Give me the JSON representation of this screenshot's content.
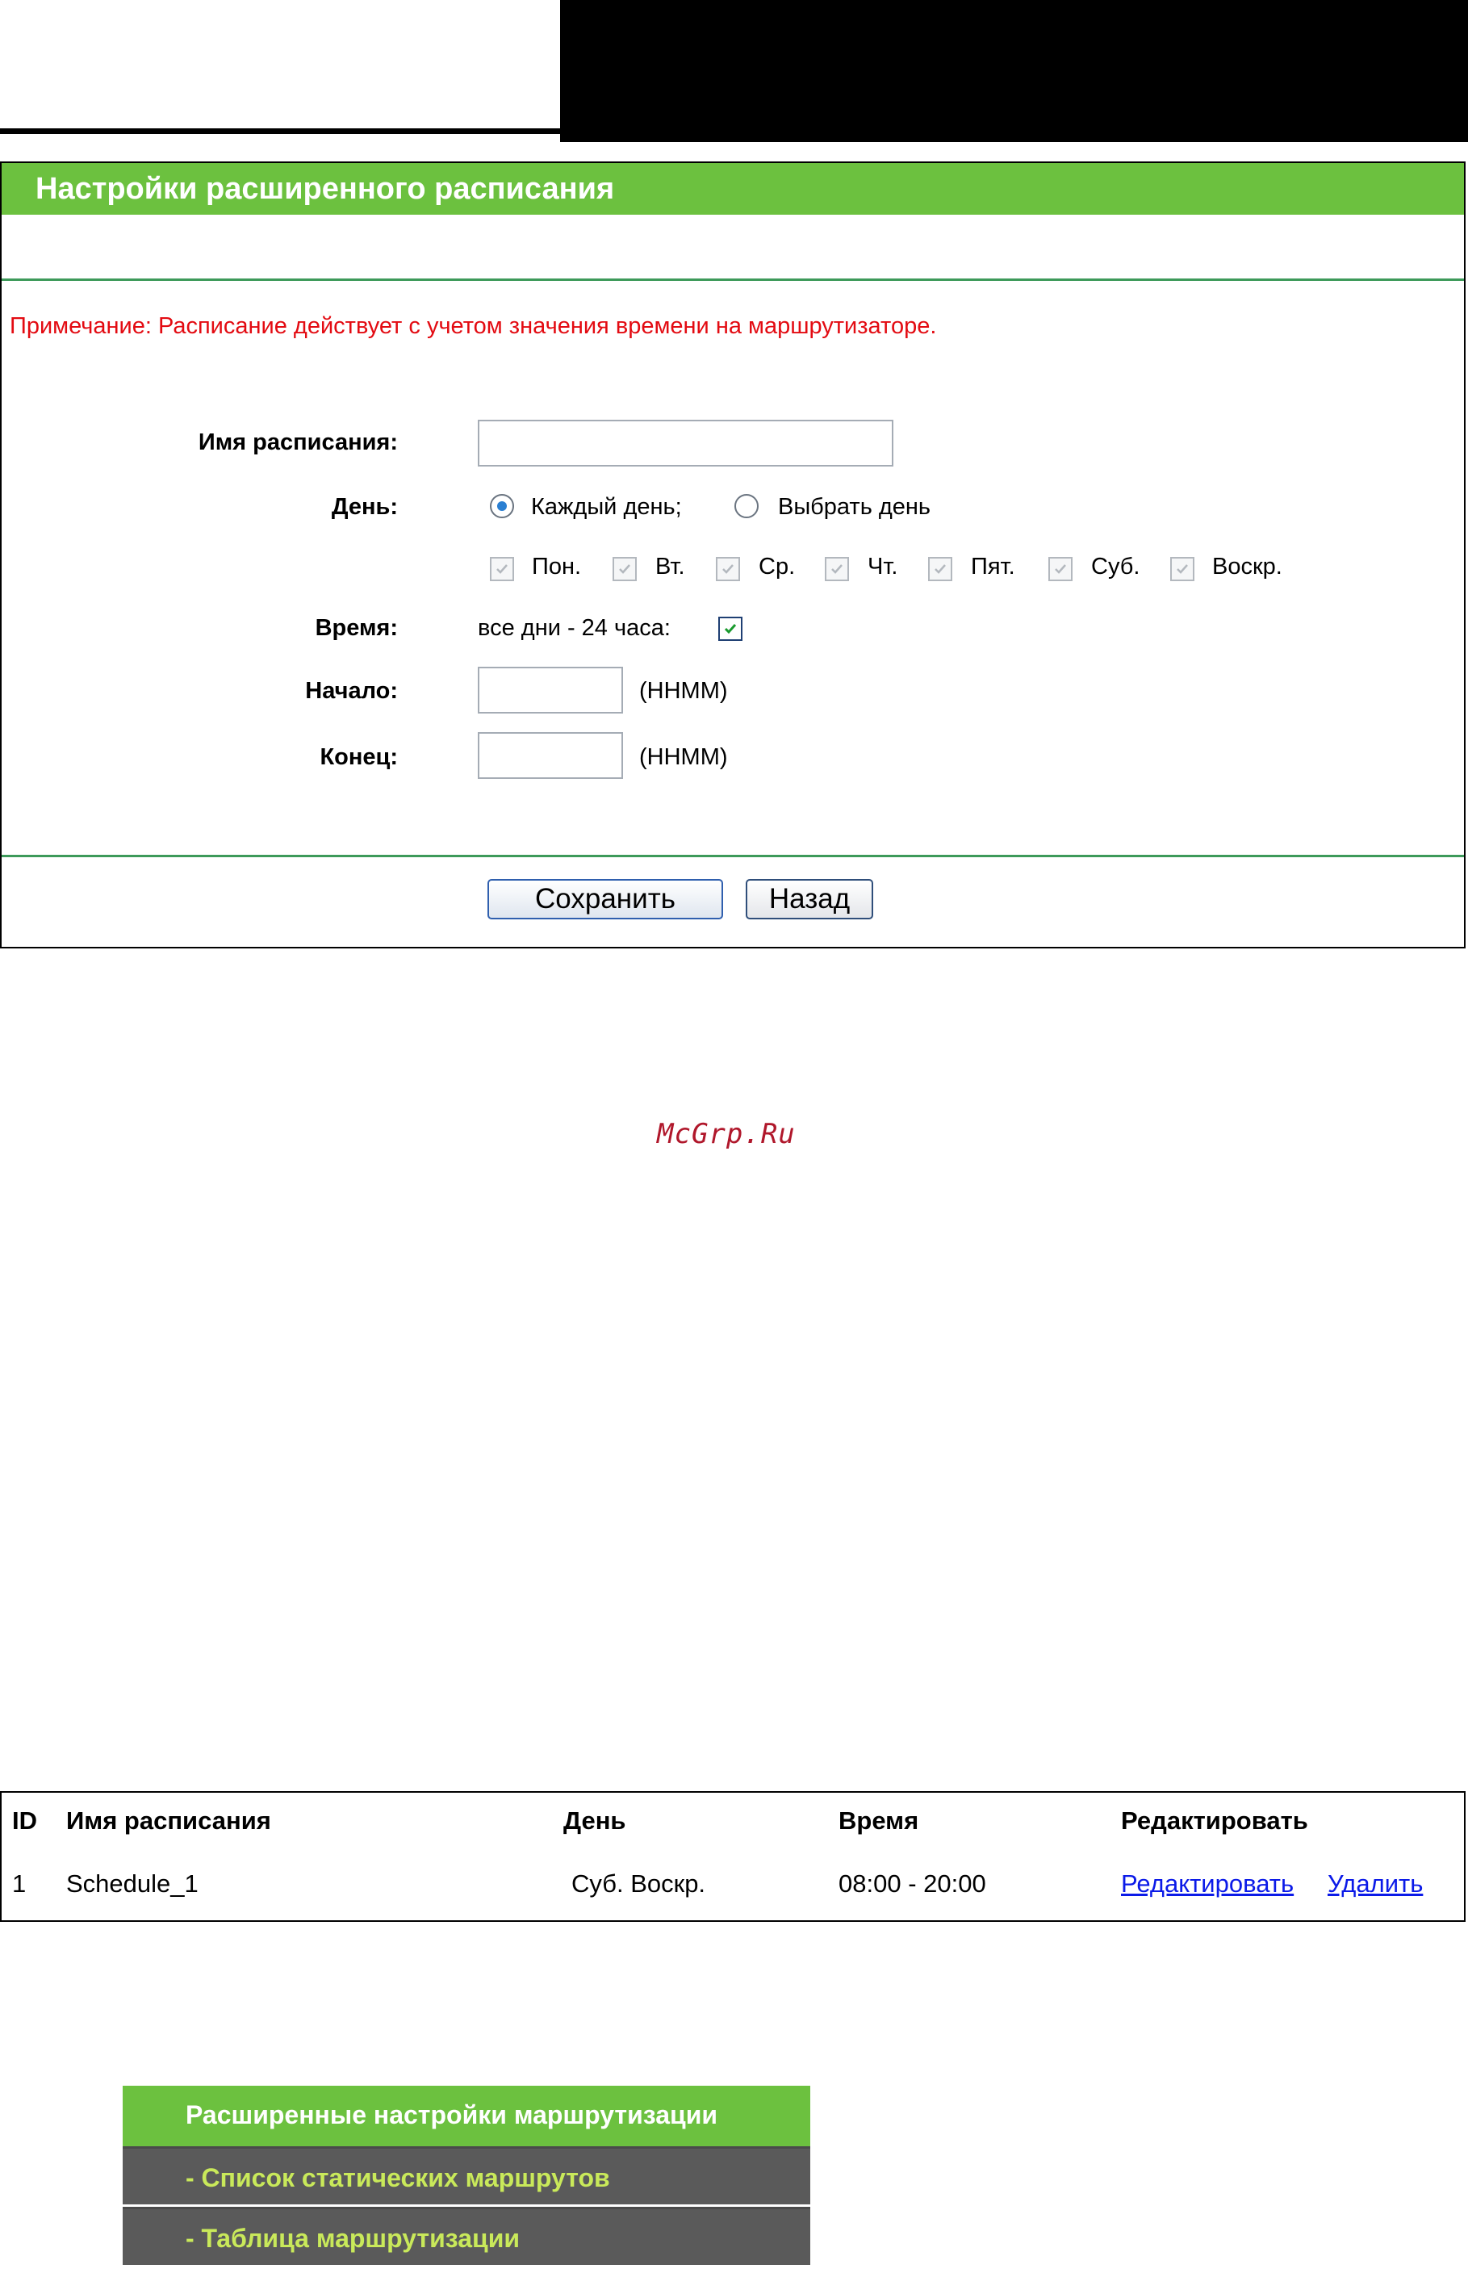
{
  "schedule_form": {
    "title": "Настройки расширенного расписания",
    "note": "Примечание: Расписание действует с учетом значения времени на маршрутизаторе.",
    "name_label": "Имя расписания:",
    "name_value": "",
    "day_label": "День:",
    "day_options": [
      {
        "label": "Каждый день;",
        "selected": true
      },
      {
        "label": "Выбрать день",
        "selected": false
      }
    ],
    "weekdays": [
      "Пон.",
      "Вт.",
      "Ср.",
      "Чт.",
      "Пят.",
      "Суб.",
      "Воскр."
    ],
    "time_label": "Время:",
    "all_day_label": "все дни - 24 часа:",
    "all_day_checked": true,
    "start_label": "Начало:",
    "start_value": "",
    "start_hint": "(HHMM)",
    "end_label": "Конец:",
    "end_value": "",
    "end_hint": "(HHMM)",
    "save_label": "Сохранить",
    "back_label": "Назад"
  },
  "watermark": "McGrp.Ru",
  "schedule_table": {
    "headers": [
      "ID",
      "Имя расписания",
      "День",
      "Время",
      "Редактировать"
    ],
    "rows": [
      {
        "id": "1",
        "name": "Schedule_1",
        "day": "Суб. Воскр.",
        "time": "08:00 - 20:00",
        "edit": "Редактировать",
        "delete": "Удалить"
      }
    ]
  },
  "routing_menu": {
    "title": "Расширенные настройки маршрутизации",
    "items": [
      "- Список статических маршрутов",
      "- Таблица маршрутизации"
    ]
  },
  "colors": {
    "title_green": "#6cc13f",
    "note_red": "#e30b12",
    "link_blue": "#0b1ae8",
    "menu_gray": "#5a5a5a",
    "menu_text": "#c9e95a"
  }
}
